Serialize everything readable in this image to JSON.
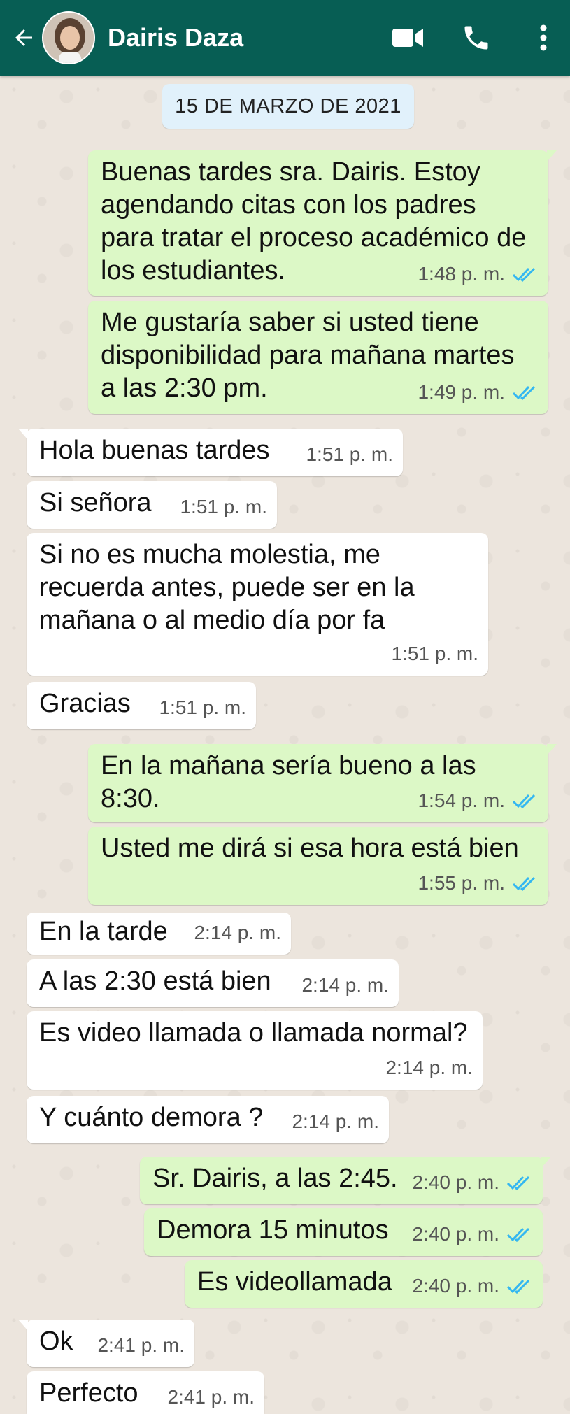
{
  "header": {
    "contact_name": "Dairis Daza"
  },
  "date_chip": "15 DE MARZO DE 2021",
  "messages": [
    {
      "text": "Buenas tardes sra. Dairis. Estoy agendando citas con los padres para tratar el proceso académico de los estudiantes.",
      "time": "1:48 p. m.",
      "direction": "outgoing",
      "status": "read"
    },
    {
      "text": "Me gustaría saber si usted tiene disponibilidad para mañana martes a las 2:30 pm.",
      "time": "1:49 p. m.",
      "direction": "outgoing",
      "status": "read"
    },
    {
      "text": "Hola buenas tardes",
      "time": "1:51 p. m.",
      "direction": "incoming"
    },
    {
      "text": "Si señora",
      "time": "1:51 p. m.",
      "direction": "incoming"
    },
    {
      "text": "Si no es mucha molestia, me recuerda antes, puede ser en la mañana o al medio día por fa",
      "time": "1:51 p. m.",
      "direction": "incoming"
    },
    {
      "text": "Gracias",
      "time": "1:51 p. m.",
      "direction": "incoming"
    },
    {
      "text": "En la mañana sería bueno a las 8:30.",
      "time": "1:54 p. m.",
      "direction": "outgoing",
      "status": "read"
    },
    {
      "text": "Usted me dirá si esa hora está bien",
      "time": "1:55 p. m.",
      "direction": "outgoing",
      "status": "read"
    },
    {
      "text": "En la tarde",
      "time": "2:14 p. m.",
      "direction": "incoming"
    },
    {
      "text": "A las 2:30 está bien",
      "time": "2:14 p. m.",
      "direction": "incoming"
    },
    {
      "text": "Es video llamada o llamada normal?",
      "time": "2:14 p. m.",
      "direction": "incoming"
    },
    {
      "text": "Y cuánto demora ?",
      "time": "2:14 p. m.",
      "direction": "incoming"
    },
    {
      "text": "Sr. Dairis, a las 2:45.",
      "time": "2:40 p. m.",
      "direction": "outgoing",
      "status": "read"
    },
    {
      "text": "Demora 15 minutos",
      "time": "2:40 p. m.",
      "direction": "outgoing",
      "status": "read"
    },
    {
      "text": "Es videollamada",
      "time": "2:40 p. m.",
      "direction": "outgoing",
      "status": "read"
    },
    {
      "text": "Ok",
      "time": "2:41 p. m.",
      "direction": "incoming"
    },
    {
      "text": "Perfecto",
      "time": "2:41 p. m.",
      "direction": "incoming"
    }
  ],
  "icons": {
    "back": "arrow-left-icon",
    "video": "video-camera-icon",
    "phone": "phone-icon",
    "menu": "more-vertical-icon",
    "read_status": "double-check-icon"
  },
  "colors": {
    "header": "#075e54",
    "outgoing_bubble": "#dcf8c6",
    "incoming_bubble": "#ffffff",
    "read_ticks": "#34b7f1",
    "date_chip": "#e1f1fb"
  }
}
